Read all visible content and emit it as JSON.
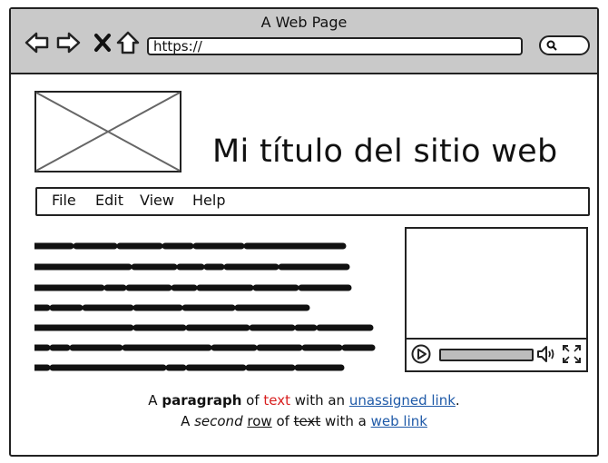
{
  "window": {
    "title": "A Web Page"
  },
  "toolbar": {
    "icons": [
      "back-arrow-icon",
      "forward-arrow-icon",
      "close-x-icon",
      "home-icon"
    ],
    "url": "https://",
    "search_icon": "search-icon"
  },
  "header": {
    "site_title": "Mi título del sitio web",
    "logo": "image-placeholder-icon"
  },
  "menu": {
    "items": [
      "File",
      "Edit",
      "View",
      "Help"
    ]
  },
  "video": {
    "controls": [
      "play-icon",
      "volume-icon",
      "fullscreen-icon"
    ],
    "progress": 0
  },
  "paragraph": {
    "line1": {
      "a": "A ",
      "bold": "paragraph",
      "b": " of ",
      "red": "text",
      "c": " with an ",
      "link": "unassigned link",
      "d": "."
    },
    "line2": {
      "a": "A ",
      "italic": "second",
      "b": " ",
      "underline": "row",
      "c": " of ",
      "strike": "text",
      "d": " with a ",
      "link": "web link"
    }
  },
  "colors": {
    "titlebar": "#c9c9c9",
    "link": "#1f5aa8",
    "red_text": "#d81e1e"
  }
}
